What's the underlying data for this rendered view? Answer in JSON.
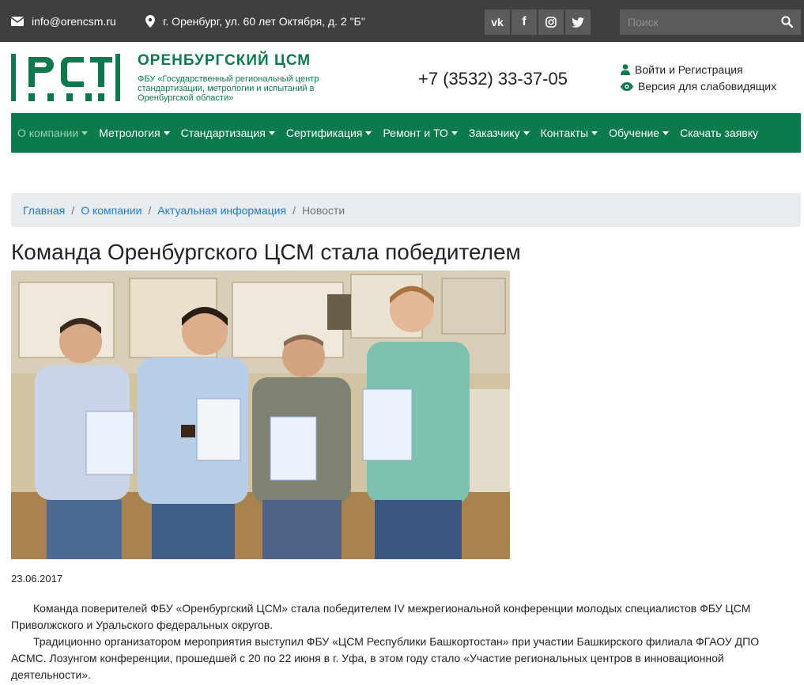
{
  "topbar": {
    "email": "info@orencsm.ru",
    "address": "г. Оренбург, ул. 60 лет Октября, д. 2 \"Б\"",
    "social": [
      {
        "icon": "vk-icon",
        "label": "vk"
      },
      {
        "icon": "facebook-icon",
        "label": "f"
      },
      {
        "icon": "instagram-icon",
        "label": ""
      },
      {
        "icon": "twitter-icon",
        "label": ""
      }
    ],
    "search_placeholder": "Поиск"
  },
  "header": {
    "logo_text": "РСТ",
    "brand_title": "ОРЕНБУРГСКИЙ ЦСМ",
    "brand_subtitle": "ФБУ «Государственный региональный центр стандартизации, метрологии и испытаний в Оренбургской области»",
    "phone": "+7 (3532) 33-37-05",
    "login_link": "Войти и Регистрация",
    "accessibility_link": "Версия для слабовидящих"
  },
  "nav": {
    "items": [
      {
        "label": "О компании",
        "dropdown": true
      },
      {
        "label": "Метрология",
        "dropdown": true
      },
      {
        "label": "Стандартизация",
        "dropdown": true
      },
      {
        "label": "Сертификация",
        "dropdown": true
      },
      {
        "label": "Ремонт и ТО",
        "dropdown": true
      },
      {
        "label": "Заказчику",
        "dropdown": true
      },
      {
        "label": "Контакты",
        "dropdown": true
      },
      {
        "label": "Обучение",
        "dropdown": true
      },
      {
        "label": "Скачать заявку",
        "dropdown": false
      }
    ]
  },
  "breadcrumb": {
    "items": [
      "Главная",
      "О компании",
      "Актуальная информация"
    ],
    "current": "Новости"
  },
  "article": {
    "title": "Команда Оренбургского ЦСМ стала победителем",
    "date": "23.06.2017",
    "paragraphs": [
      "Команда поверителей ФБУ «Оренбургский ЦСМ» стала победителем IV межрегиональной конференции молодых специалистов ФБУ ЦСМ Приволжского и Уральского федеральных округов.",
      "Традиционно организатором мероприятия выступил ФБУ «ЦСМ Республики Башкортостан» при участии Башкирского филиала ФГАОУ ДПО АСМС. Лозунгом конференции, прошедшей с 20 по 22 июня в г. Уфа, в этом году стало «Участие региональных центров в инновационной деятельности»."
    ]
  },
  "colors": {
    "brand_green": "#0b7a4c",
    "topbar_bg": "#3e3f40",
    "link_blue": "#1f7bd4",
    "nav_active": "#9ad0b5"
  }
}
